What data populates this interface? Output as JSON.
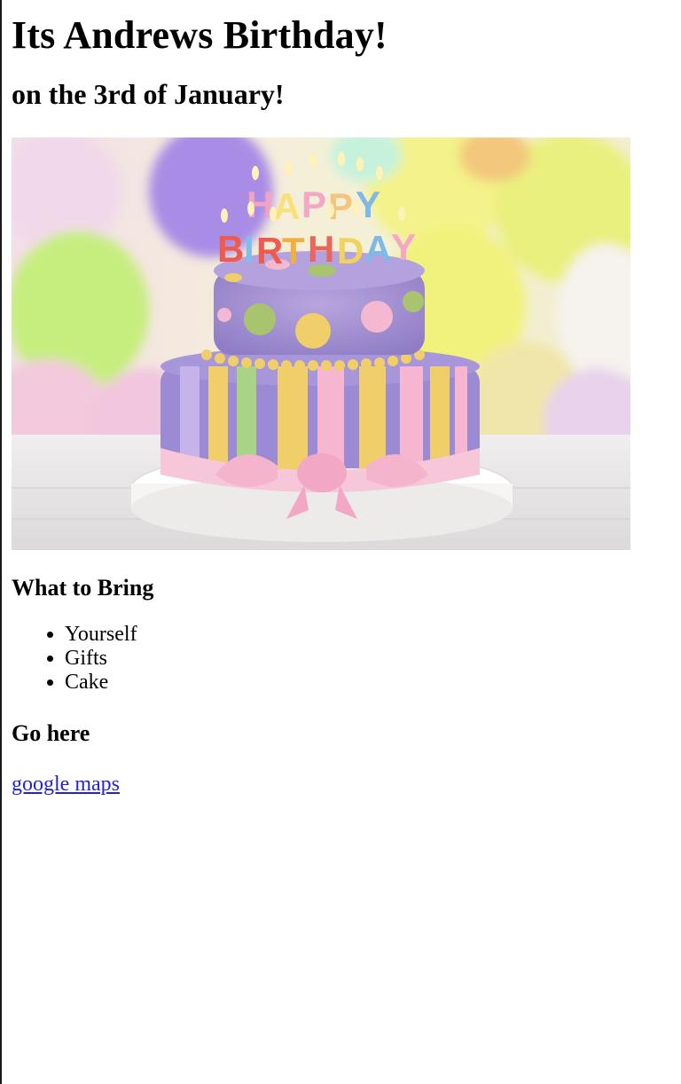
{
  "page": {
    "title": "Its Andrews Birthday!",
    "subtitle": "on the 3rd of January!"
  },
  "image": {
    "subject": "birthday-cake-with-balloons",
    "cake_text_line1": "HAPPY",
    "cake_text_line2": "BIRTHDAY"
  },
  "bring": {
    "heading": "What to Bring",
    "items": [
      "Yourself",
      "Gifts",
      "Cake"
    ]
  },
  "location": {
    "heading": "Go here",
    "link_text": "google maps"
  },
  "colors": {
    "link": "#2323d6",
    "text": "#000000",
    "background": "#ffffff"
  }
}
